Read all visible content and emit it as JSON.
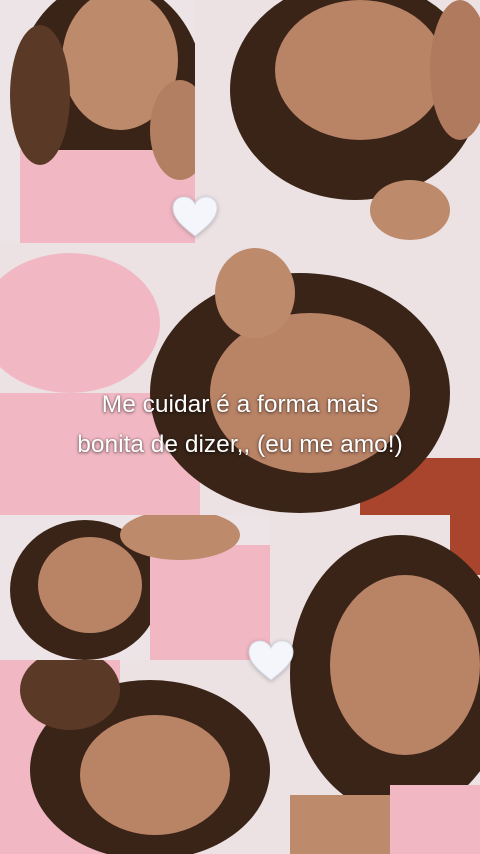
{
  "caption": {
    "line1": "Me cuidar é a forma mais",
    "line2": "bonita de dizer,, (eu me amo!)"
  },
  "decorations": [
    "heart-icon",
    "heart-icon"
  ],
  "colors": {
    "wall": "#ece2e4",
    "top_pink": "#f1b8c3",
    "hair": "#3a2418",
    "skin": "#b98366",
    "caption_text": "#ffffff"
  }
}
